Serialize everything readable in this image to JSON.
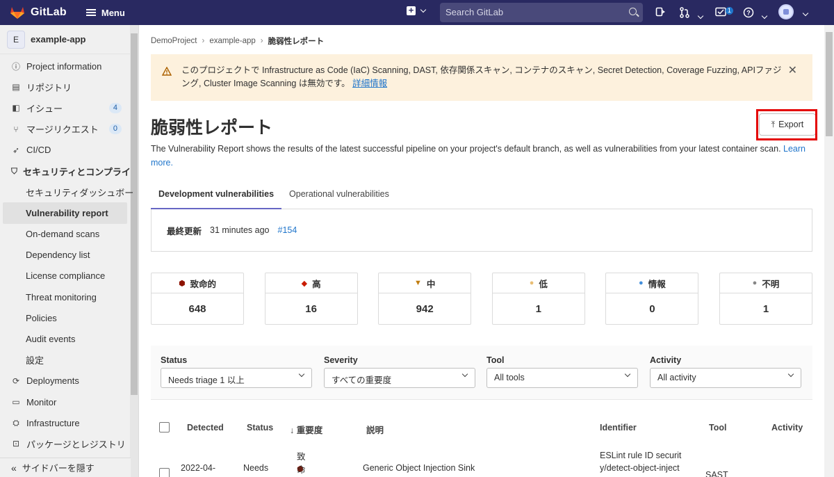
{
  "topbar": {
    "brand": "GitLab",
    "menu_label": "Menu",
    "search_placeholder": "Search GitLab",
    "todo_count": "1"
  },
  "sidebar": {
    "project_initial": "E",
    "project_name": "example-app",
    "items": [
      {
        "label": "Project information",
        "icon": "info-icon"
      },
      {
        "label": "リポジトリ",
        "icon": "repository-icon"
      },
      {
        "label": "イシュー",
        "icon": "issues-icon",
        "count": "4"
      },
      {
        "label": "マージリクエスト",
        "icon": "merge-request-icon",
        "count": "0"
      },
      {
        "label": "CI/CD",
        "icon": "rocket-icon"
      },
      {
        "label": "セキュリティとコンプライ",
        "icon": "shield-icon"
      },
      {
        "label": "セキュリティダッシュボー"
      },
      {
        "label": "Vulnerability report"
      },
      {
        "label": "On-demand scans"
      },
      {
        "label": "Dependency list"
      },
      {
        "label": "License compliance"
      },
      {
        "label": "Threat monitoring"
      },
      {
        "label": "Policies"
      },
      {
        "label": "Audit events"
      },
      {
        "label": "設定"
      },
      {
        "label": "Deployments",
        "icon": "deployments-icon"
      },
      {
        "label": "Monitor",
        "icon": "monitor-icon"
      },
      {
        "label": "Infrastructure",
        "icon": "infrastructure-icon"
      },
      {
        "label": "パッケージとレジストリ",
        "icon": "package-icon"
      }
    ],
    "hide_label": "サイドバーを隠す"
  },
  "breadcrumb": [
    "DemoProject",
    "example-app",
    "脆弱性レポート"
  ],
  "alert": {
    "text": "このプロジェクトで Infrastructure as Code (IaC) Scanning, DAST, 依存関係スキャン, コンテナのスキャン, Secret Detection, Coverage Fuzzing, APIファジング, Cluster Image Scanning は無効です。",
    "link": "詳細情報"
  },
  "page": {
    "title": "脆弱性レポート",
    "export_label": "Export",
    "description": "The Vulnerability Report shows the results of the latest successful pipeline on your project's default branch, as well as vulnerabilities from your latest container scan.",
    "learn_more": "Learn more."
  },
  "tabs": [
    "Development vulnerabilities",
    "Operational vulnerabilities"
  ],
  "last_updated": {
    "label": "最終更新",
    "time": "31 minutes ago",
    "pipeline": "#154"
  },
  "severities": [
    {
      "label": "致命的",
      "count": "648",
      "color": "#8d1300",
      "icon": "critical-icon"
    },
    {
      "label": "高",
      "count": "16",
      "color": "#c91c00",
      "icon": "high-icon"
    },
    {
      "label": "中",
      "count": "942",
      "color": "#c17d10",
      "icon": "medium-icon"
    },
    {
      "label": "低",
      "count": "1",
      "color": "#e9be74",
      "icon": "low-icon"
    },
    {
      "label": "情報",
      "count": "0",
      "color": "#428fdc",
      "icon": "info-icon"
    },
    {
      "label": "不明",
      "count": "1",
      "color": "#868686",
      "icon": "unknown-icon"
    }
  ],
  "filters": [
    {
      "label": "Status",
      "value": "Needs triage 1 以上"
    },
    {
      "label": "Severity",
      "value": "すべての重要度"
    },
    {
      "label": "Tool",
      "value": "All tools"
    },
    {
      "label": "Activity",
      "value": "All activity"
    }
  ],
  "table": {
    "headers": [
      "Detected",
      "Status",
      "↓ 重要度",
      "説明",
      "Identifier",
      "Tool",
      "Activity"
    ],
    "rows": [
      {
        "detected_line1": "2022-04-",
        "status": "Needs",
        "severity": "致命的",
        "description": "Generic Object Injection Sink",
        "identifier_line1": "ESLint rule ID securit",
        "identifier_line2": "y/detect-object-inject",
        "tool": "SAST"
      }
    ]
  }
}
